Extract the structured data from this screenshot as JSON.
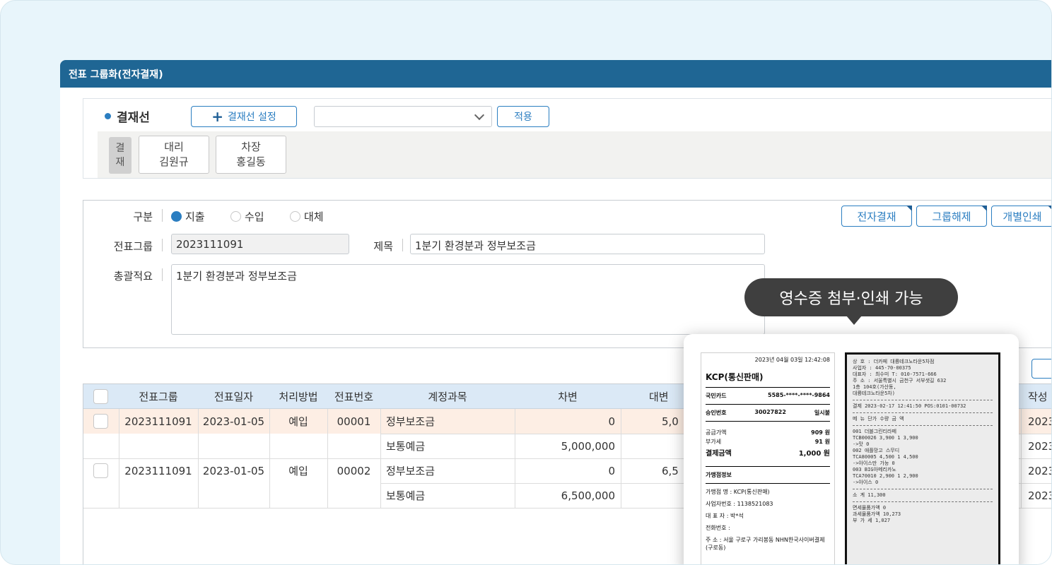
{
  "window": {
    "title": "전표 그룹화(전자결재)"
  },
  "approval": {
    "title": "결재선",
    "set_button": "결재선 설정",
    "select_value": "",
    "apply_button": "적용",
    "head_label": [
      "결",
      "재"
    ],
    "approvers": [
      {
        "position": "대리",
        "name": "김원규"
      },
      {
        "position": "차장",
        "name": "홍길동"
      }
    ]
  },
  "form": {
    "type_label": "구분",
    "types": [
      "지출",
      "수입",
      "대체"
    ],
    "selected_type": "지출",
    "group_label": "전표그룹",
    "group_value": "2023111091",
    "subject_label": "제목",
    "subject_value": "1분기 환경분과 정부보조금",
    "summary_label": "총괄적요",
    "summary_value": "1분기 환경분과 정부보조금",
    "buttons": [
      "전자결재",
      "그룹해제",
      "개별인쇄"
    ]
  },
  "grid": {
    "columns": [
      "전표그룹",
      "전표일자",
      "처리방법",
      "전표번호",
      "계정과목",
      "차변",
      "대변",
      "작성"
    ],
    "rows": [
      {
        "group": "2023111091",
        "date": "2023-01-05",
        "method": "예입",
        "number": "00001",
        "lines": [
          {
            "account": "정부보조금",
            "debit": "0",
            "credit": "5,0",
            "writer": "2023"
          },
          {
            "account": "보통예금",
            "debit": "5,000,000",
            "credit": "",
            "writer": "2023"
          }
        ]
      },
      {
        "group": "2023111091",
        "date": "2023-01-05",
        "method": "예입",
        "number": "00002",
        "lines": [
          {
            "account": "정부보조금",
            "debit": "0",
            "credit": "6,5",
            "writer": "2023"
          },
          {
            "account": "보통예금",
            "debit": "6,500,000",
            "credit": "",
            "writer": "2023"
          }
        ]
      }
    ]
  },
  "tooltip": {
    "text": "영수증 첨부·인쇄 가능"
  },
  "receipt1": {
    "datetime": "2023년 04월 03일 12:42:08",
    "merchant_title": "KCP(통신판매)",
    "card_label": "국민카드",
    "card_number": "5585-****-****-9864",
    "approval_label": "승인번호",
    "approval_number": "30027822",
    "installment": "일시불",
    "supply_label": "공급가액",
    "supply_value": "909 원",
    "vat_label": "부가세",
    "vat_value": "91 원",
    "total_label": "결제금액",
    "total_value": "1,000 원",
    "store_info_title": "가맹점정보",
    "store_name_label": "가맹점 명 :",
    "store_name": "KCP(통신판매)",
    "biz_no_label": "사업자번호 :",
    "biz_no": "1138521083",
    "ceo_label": "대 표 자 :",
    "ceo": "박*석",
    "phone_label": "전화번호 :",
    "phone": "",
    "address_label": "주    소 :",
    "address": "서울 구로구 가리봉동 NHN한국사이버결제 (구로동)"
  },
  "receipt2": {
    "lines": [
      "상  호 : 더카페 대륭테크노타운5차점",
      "사업자 : 445-70-00375",
      "대표자 : 최수미  T: 010-7571-666",
      "주  소 : 서울특별시 금천구 서부샛길 632",
      "        1층 104호(가산동,",
      "        대륭테크노타운5차)",
      "결제 2023-02-17 12:41:50 POS:0101-00732",
      "  메  뉴        단가  수량     금 액",
      "001  더블그린티라떼",
      "TCB00026         3,900    1    3,900",
      "  ->맛                            0",
      "002  애플망고 스무디",
      "TCA80005         4,500    1    4,500",
      "  ->아이스만 가능                 0",
      "003  BIG아메리카노",
      "TCA70010         2,900    1    2,900",
      "  ->아이스                        0",
      "소      계                   11,300",
      "면세물품가액                      0",
      "과세물품가액                 10,273",
      "부  가  세                    1,027"
    ]
  }
}
